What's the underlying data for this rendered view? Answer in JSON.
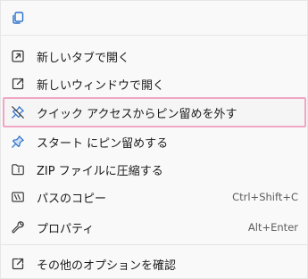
{
  "top_bar": {
    "icon": "copy-icon"
  },
  "items": [
    {
      "icon": "open-in-new-tab-icon",
      "label": "新しいタブで開く",
      "shortcut": ""
    },
    {
      "icon": "open-in-new-window-icon",
      "label": "新しいウィンドウで開く",
      "shortcut": ""
    },
    {
      "icon": "unpin-icon",
      "label": "クイック アクセスからピン留めを外す",
      "shortcut": ""
    },
    {
      "icon": "pin-icon",
      "label": "スタート にピン留めする",
      "shortcut": ""
    },
    {
      "icon": "zip-folder-icon",
      "label": "ZIP ファイルに圧縮する",
      "shortcut": ""
    },
    {
      "icon": "copy-path-icon",
      "label": "パスのコピー",
      "shortcut": "Ctrl+Shift+C"
    },
    {
      "icon": "wrench-icon",
      "label": "プロパティ",
      "shortcut": "Alt+Enter"
    },
    {
      "icon": "more-options-icon",
      "label": "その他のオプションを確認",
      "shortcut": ""
    }
  ],
  "highlighted_item": "クイック アクセスからピン留めを外す",
  "colors": {
    "highlight_border": "#f0a6c6",
    "icon_blue": "#2a6fc9",
    "icon_dark": "#3a3a3a"
  }
}
